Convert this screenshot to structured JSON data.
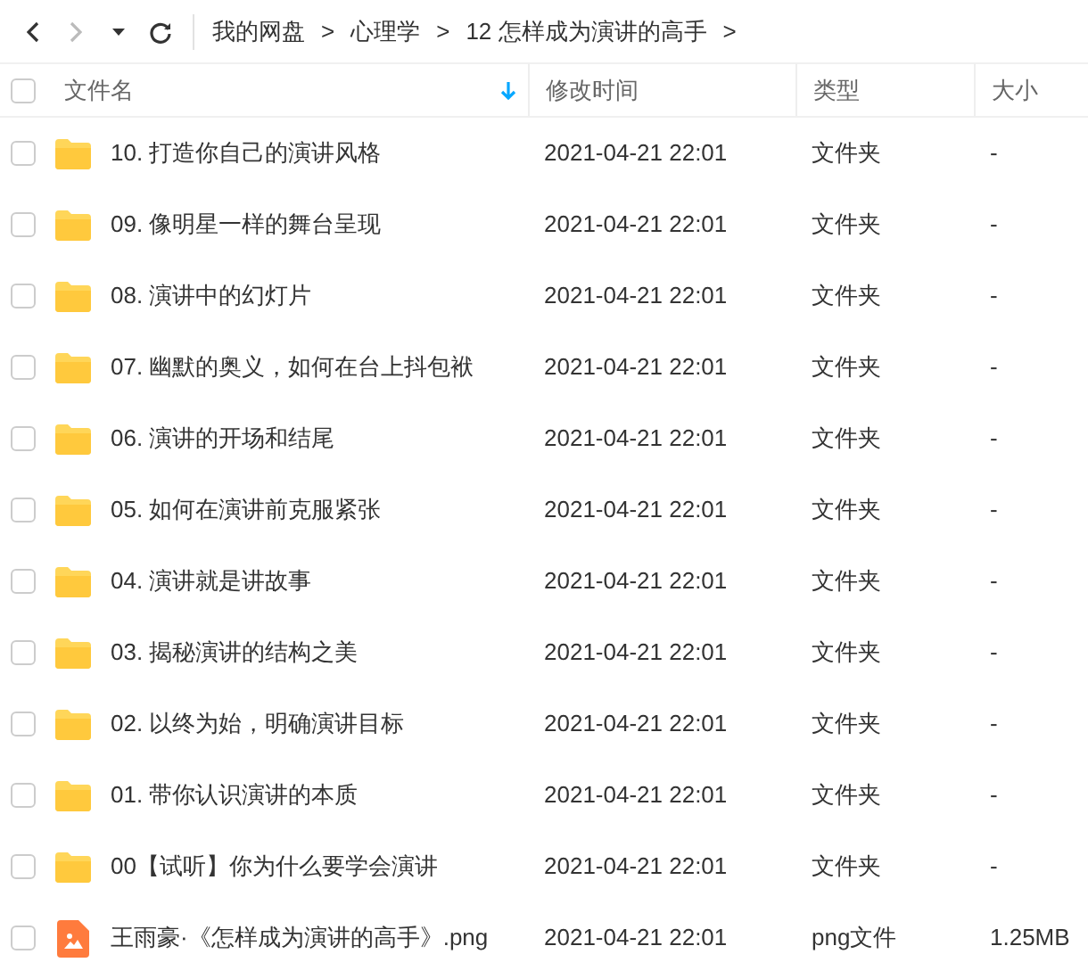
{
  "toolbar": {
    "breadcrumb": [
      {
        "label": "我的网盘",
        "separator": ">"
      },
      {
        "label": "心理学",
        "separator": ">"
      },
      {
        "label": "12 怎样成为演讲的高手",
        "separator": ">"
      }
    ]
  },
  "table": {
    "select_all": {
      "checked": false
    },
    "columns": [
      {
        "label": "文件名",
        "sorted": true
      },
      {
        "label": "修改时间",
        "sorted": false
      },
      {
        "label": "类型",
        "sorted": false
      },
      {
        "label": "大小",
        "sorted": false
      }
    ],
    "rows": [
      {
        "kind": "folder",
        "checked": false,
        "name": "10. 打造你自己的演讲风格",
        "modified": "2021-04-21 22:01",
        "type": "文件夹",
        "size": "-"
      },
      {
        "kind": "folder",
        "checked": false,
        "name": "09. 像明星一样的舞台呈现",
        "modified": "2021-04-21 22:01",
        "type": "文件夹",
        "size": "-"
      },
      {
        "kind": "folder",
        "checked": false,
        "name": "08. 演讲中的幻灯片",
        "modified": "2021-04-21 22:01",
        "type": "文件夹",
        "size": "-"
      },
      {
        "kind": "folder",
        "checked": false,
        "name": "07. 幽默的奥义，如何在台上抖包袱",
        "modified": "2021-04-21 22:01",
        "type": "文件夹",
        "size": "-"
      },
      {
        "kind": "folder",
        "checked": false,
        "name": "06. 演讲的开场和结尾",
        "modified": "2021-04-21 22:01",
        "type": "文件夹",
        "size": "-"
      },
      {
        "kind": "folder",
        "checked": false,
        "name": "05. 如何在演讲前克服紧张",
        "modified": "2021-04-21 22:01",
        "type": "文件夹",
        "size": "-"
      },
      {
        "kind": "folder",
        "checked": false,
        "name": "04. 演讲就是讲故事",
        "modified": "2021-04-21 22:01",
        "type": "文件夹",
        "size": "-"
      },
      {
        "kind": "folder",
        "checked": false,
        "name": "03. 揭秘演讲的结构之美",
        "modified": "2021-04-21 22:01",
        "type": "文件夹",
        "size": "-"
      },
      {
        "kind": "folder",
        "checked": false,
        "name": "02. 以终为始，明确演讲目标",
        "modified": "2021-04-21 22:01",
        "type": "文件夹",
        "size": "-"
      },
      {
        "kind": "folder",
        "checked": false,
        "name": "01. 带你认识演讲的本质",
        "modified": "2021-04-21 22:01",
        "type": "文件夹",
        "size": "-"
      },
      {
        "kind": "folder",
        "checked": false,
        "name": "00【试听】你为什么要学会演讲",
        "modified": "2021-04-21 22:01",
        "type": "文件夹",
        "size": "-"
      },
      {
        "kind": "image",
        "checked": false,
        "name": "王雨豪·《怎样成为演讲的高手》.png",
        "modified": "2021-04-21 22:01",
        "type": "png文件",
        "size": "1.25MB"
      }
    ]
  }
}
